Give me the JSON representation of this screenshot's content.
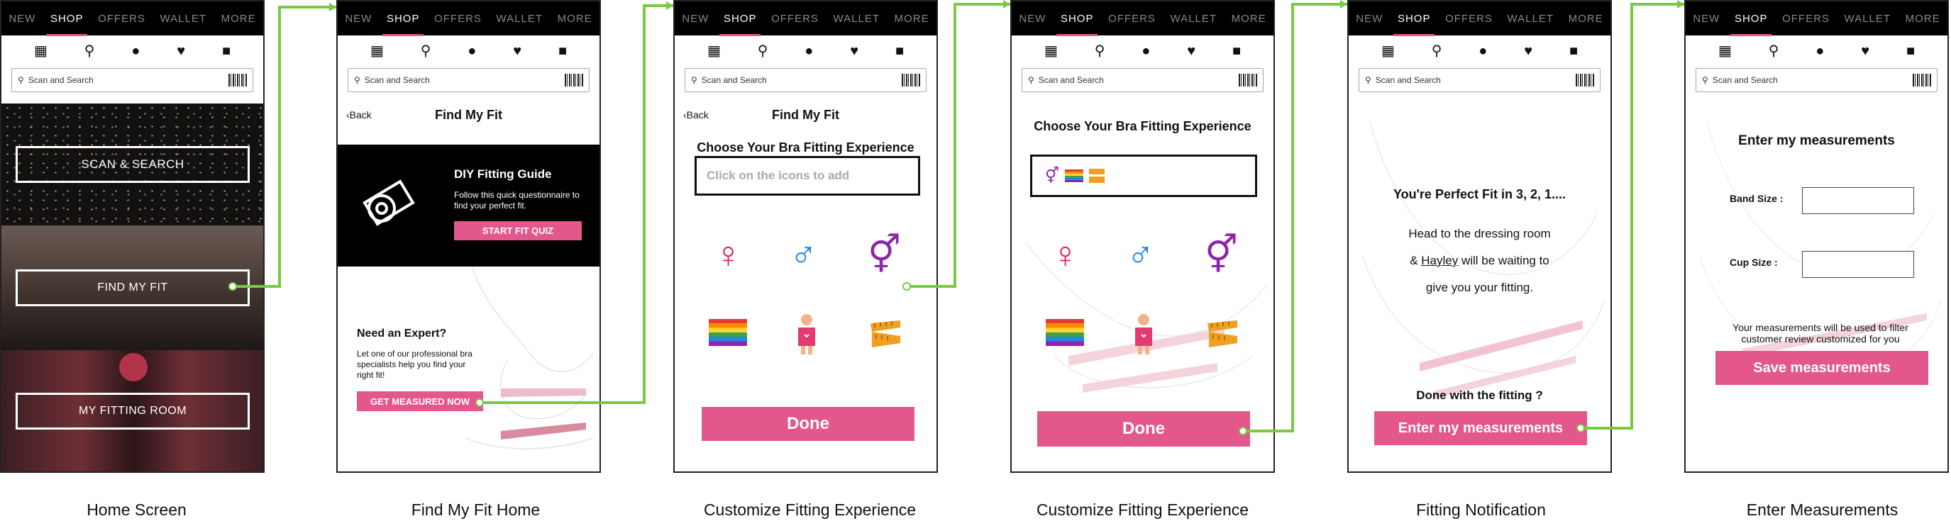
{
  "nav": {
    "tabs": [
      "NEW",
      "SHOP",
      "OFFERS",
      "WALLET",
      "MORE"
    ],
    "active": "SHOP"
  },
  "search": {
    "placeholder": "Scan and Search"
  },
  "captions": [
    "Home Screen",
    "Find My Fit Home",
    "Customize Fitting Experience",
    "Customize Fitting Experience",
    "Fitting Notification",
    "Enter Measurements"
  ],
  "home": {
    "scan_search": "SCAN & SEARCH",
    "find_my_fit": "FIND MY FIT",
    "my_fitting_room": "MY FITTING ROOM"
  },
  "fit_home": {
    "back": "Back",
    "title": "Find My Fit",
    "diy_title": "DIY Fitting Guide",
    "diy_text": "Follow this quick questionnaire to find your perfect fit.",
    "start_quiz": "START FIT QUIZ",
    "expert_title": "Need an Expert?",
    "expert_text": "Let one of our professional bra specialists help you find your right fit!",
    "get_measured": "GET MEASURED NOW"
  },
  "customize1": {
    "back": "Back",
    "title": "Find My Fit",
    "heading": "Choose Your Bra Fitting Experience",
    "placeholder": "Click on the icons to add",
    "done": "Done"
  },
  "customize2": {
    "heading": "Choose Your Bra Fitting Experience",
    "done": "Done"
  },
  "icons_grid": [
    "female-sign",
    "male-sign",
    "transgender-sign",
    "rainbow-flag",
    "woman-figure",
    "measuring-tape"
  ],
  "notification": {
    "title": "You're Perfect Fit in 3, 2, 1....",
    "line1": "Head to the dressing room",
    "line2_pre": "& ",
    "line2_name": "Hayley",
    "line2_post": " will be waiting to",
    "line3": "give you your fitting.",
    "done_q": "Done with the fitting ?",
    "enter_btn": "Enter my measurements"
  },
  "measure": {
    "title": "Enter my measurements",
    "band": "Band Size :",
    "cup": "Cup Size :",
    "note": "Your measurements will be used to filter customer review customized for you",
    "save": "Save measurements"
  },
  "colors": {
    "accent": "#e4578d",
    "connector": "#7ac943"
  }
}
